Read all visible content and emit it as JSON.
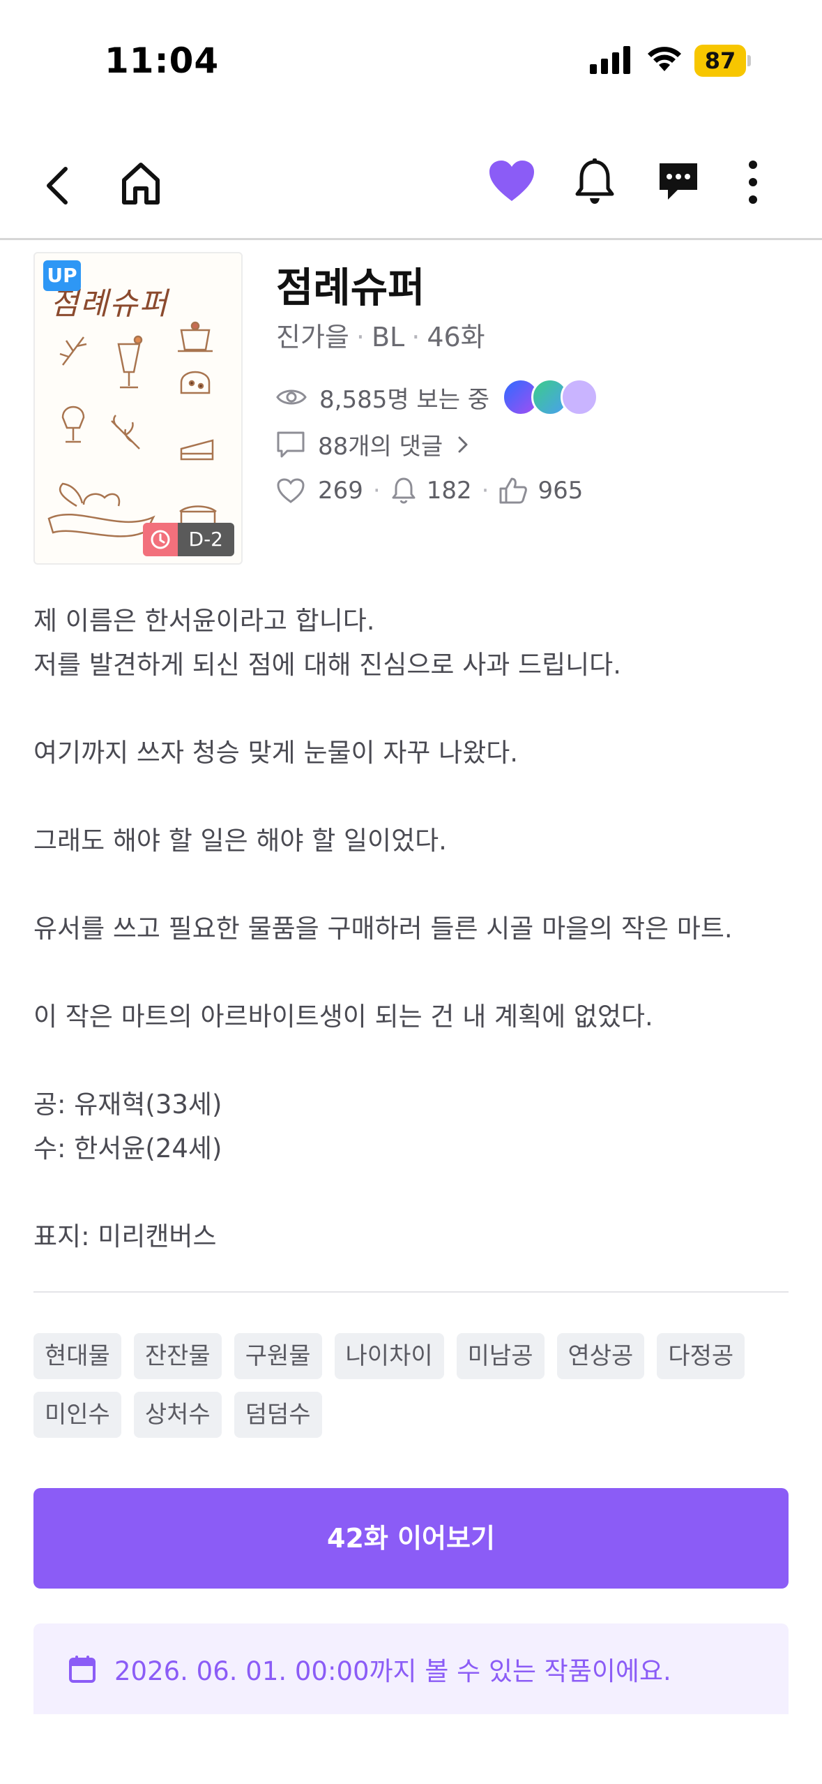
{
  "status_bar": {
    "time": "11:04",
    "battery": "87"
  },
  "nav": {
    "icons": [
      "back-icon",
      "home-icon",
      "heart-icon",
      "bell-icon",
      "chat-icon",
      "more-icon"
    ],
    "accent": "#8b5cf6"
  },
  "work": {
    "cover_title": "점례슈퍼",
    "up_badge": "UP",
    "dday": "D-2",
    "title": "점례슈퍼",
    "author": "진가을",
    "genre": "BL",
    "episodes": "46화",
    "viewers": "8,585명 보는 중",
    "comments": "88개의 댓글",
    "likes": "269",
    "subscribers": "182",
    "recommends": "965"
  },
  "description": [
    "제 이름은 한서윤이라고 합니다.",
    "저를 발견하게 되신 점에 대해 진심으로 사과 드립니다.",
    "",
    "여기까지 쓰자 청승 맞게 눈물이 자꾸 나왔다.",
    "",
    "그래도 해야 할 일은 해야 할 일이었다.",
    "",
    "유서를 쓰고 필요한 물품을 구매하러 들른 시골 마을의 작은 마트.",
    "",
    "이 작은 마트의 아르바이트생이 되는 건 내 계획에 없었다.",
    "",
    "공: 유재혁(33세)",
    "수: 한서윤(24세)",
    "",
    "표지: 미리캔버스"
  ],
  "tags": [
    "현대물",
    "잔잔물",
    "구원물",
    "나이차이",
    "미남공",
    "연상공",
    "다정공",
    "미인수",
    "상처수",
    "덤덤수"
  ],
  "cta": {
    "label": "42화 이어보기",
    "color": "#8b5cf6"
  },
  "notice": {
    "text": "2026. 06. 01. 00:00까지 볼 수 있는 작품이에요."
  }
}
